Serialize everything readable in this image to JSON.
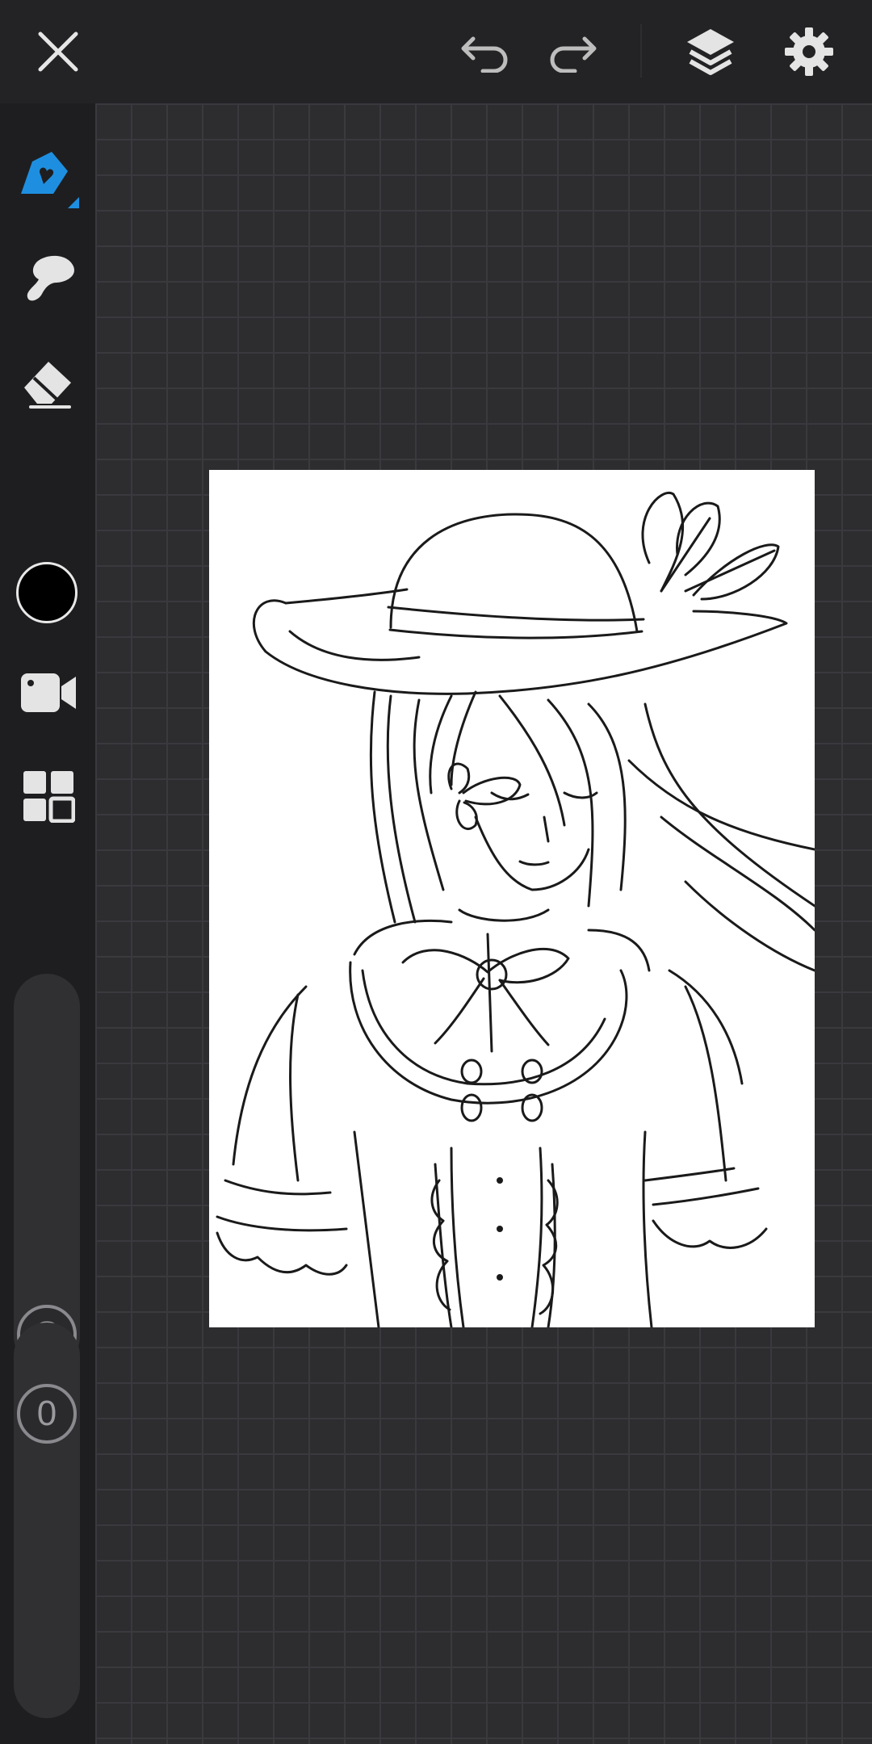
{
  "app": {
    "top_bar": {
      "icons": [
        "close-icon",
        "undo-icon",
        "redo-icon",
        "layers-icon",
        "settings-gear-icon"
      ]
    },
    "tools": {
      "icons": [
        "brush-icon",
        "smudge-icon",
        "eraser-icon",
        "color-picker",
        "video-record-icon",
        "gallery-grid-icon"
      ],
      "active_tool": "brush",
      "current_color": "#000000"
    },
    "sliders": {
      "size_label": "S",
      "opacity_label": "0"
    },
    "colors": {
      "accent": "#1e8fe0",
      "background": "#2b2b2d",
      "sidebar": "#1e1e20",
      "icon": "#e4e4e4"
    }
  }
}
